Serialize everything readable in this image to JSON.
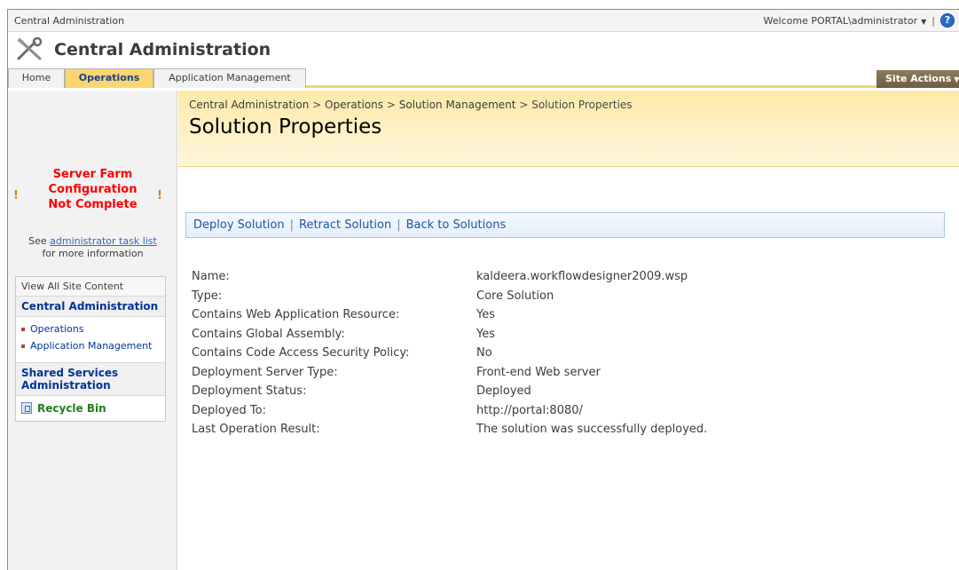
{
  "global": {
    "site_name": "Central Administration",
    "welcome": "Welcome PORTAL\\administrator",
    "help_glyph": "?"
  },
  "header": {
    "app_title": "Central Administration",
    "icon": "tools-icon"
  },
  "tabs": [
    {
      "label": "Home",
      "active": false
    },
    {
      "label": "Operations",
      "active": true
    },
    {
      "label": "Application Management",
      "active": false
    }
  ],
  "site_actions": {
    "label": "Site Actions"
  },
  "alert": {
    "line1": "Server Farm",
    "line2": "Configuration",
    "line3": "Not Complete",
    "see_prefix": "See",
    "link_text": "administrator task list",
    "suffix": "for more information"
  },
  "quicklaunch": {
    "view_all": "View All Site Content",
    "section1": "Central Administration",
    "items": [
      "Operations",
      "Application Management"
    ],
    "section2": "Shared Services Administration",
    "recycle": "Recycle Bin"
  },
  "breadcrumb": {
    "items": [
      "Central Administration",
      "Operations",
      "Solution Management",
      "Solution Properties"
    ],
    "separator": ">"
  },
  "page_title": "Solution Properties",
  "toolbar": {
    "deploy": "Deploy Solution",
    "retract": "Retract Solution",
    "back": "Back to Solutions",
    "separator": "|"
  },
  "properties": [
    {
      "label": "Name:",
      "value": "kaldeera.workflowdesigner2009.wsp"
    },
    {
      "label": "Type:",
      "value": "Core Solution"
    },
    {
      "label": "Contains Web Application Resource:",
      "value": "Yes"
    },
    {
      "label": "Contains Global Assembly:",
      "value": "Yes"
    },
    {
      "label": "Contains Code Access Security Policy:",
      "value": "No"
    },
    {
      "label": "Deployment Server Type:",
      "value": "Front-end Web server"
    },
    {
      "label": "Deployment Status:",
      "value": "Deployed"
    },
    {
      "label": "Deployed To:",
      "value": "http://portal:8080/"
    },
    {
      "label": "Last Operation Result:",
      "value": "The solution was successfully deployed."
    }
  ],
  "colors": {
    "accent_gold": "#fcd570",
    "nav_blue": "#003399",
    "alert_red": "#ff0000",
    "recycle_green": "#1d7f1d"
  }
}
